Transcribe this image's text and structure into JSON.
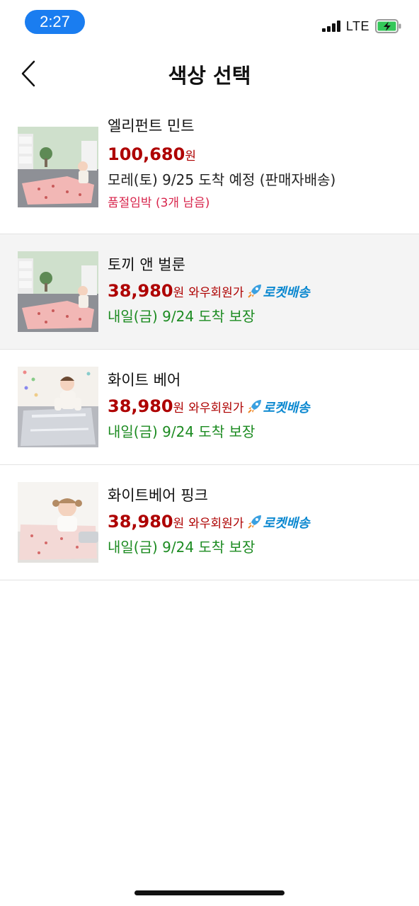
{
  "status_bar": {
    "time": "2:27",
    "network": "LTE",
    "icons": [
      "signal-icon",
      "battery-charging-icon"
    ]
  },
  "nav": {
    "title": "색상 선택",
    "back_icon": "chevron-left-icon"
  },
  "options": [
    {
      "name": "엘리펀트 민트",
      "price": "100,680",
      "currency": "원",
      "member_label": "",
      "rocket_label": "",
      "delivery": "모레(토) 9/25 도착 예정 (판매자배송)",
      "stock_note": "품절임박 (3개 남음)",
      "selected": false
    },
    {
      "name": "토끼 앤 벌룬",
      "price": "38,980",
      "currency": "원",
      "member_label": "와우회원가",
      "rocket_label": "로켓배송",
      "delivery": "내일(금) 9/24 도착 보장",
      "stock_note": "",
      "selected": true
    },
    {
      "name": "화이트 베어",
      "price": "38,980",
      "currency": "원",
      "member_label": "와우회원가",
      "rocket_label": "로켓배송",
      "delivery": "내일(금) 9/24 도착 보장",
      "stock_note": "",
      "selected": false
    },
    {
      "name": "화이트베어 핑크",
      "price": "38,980",
      "currency": "원",
      "member_label": "와우회원가",
      "rocket_label": "로켓배송",
      "delivery": "내일(금) 9/24 도착 보장",
      "stock_note": "",
      "selected": false
    }
  ],
  "colors": {
    "price": "#ae0000",
    "delivery_green": "#1c8b21",
    "stock_warning": "#d8254c",
    "rocket_blue": "#0b88d0",
    "selected_row_bg": "#f4f4f4",
    "time_pill": "#1a7df0"
  }
}
